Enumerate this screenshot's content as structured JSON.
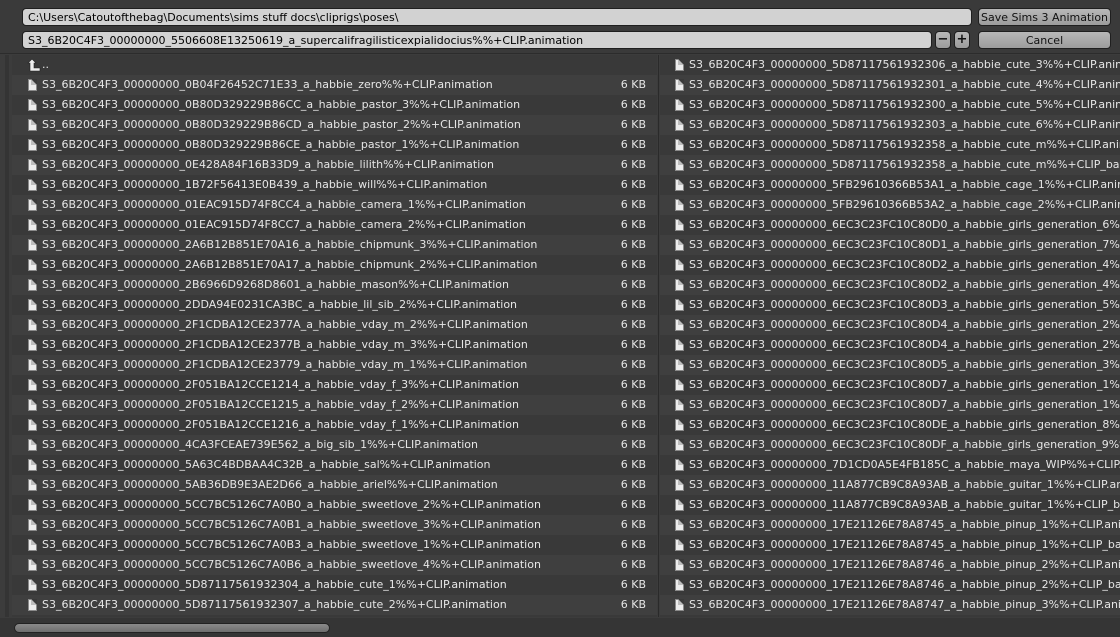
{
  "path": "C:\\Users\\Catoutofthebag\\Documents\\sims stuff docs\\cliprigs\\poses\\",
  "filename": "S3_6B20C4F3_00000000_5506608E13250619_a_supercalifragilisticexpialidocius%%+CLIP.animation",
  "buttons": {
    "save": "Save Sims 3 Animation",
    "cancel": "Cancel",
    "minus": "−",
    "plus": "+"
  },
  "parent_dir": "..",
  "left_files": [
    {
      "name": "S3_6B20C4F3_00000000_0B04F26452C71E33_a_habbie_zero%%+CLIP.animation",
      "size": "6 KB"
    },
    {
      "name": "S3_6B20C4F3_00000000_0B80D329229B86CC_a_habbie_pastor_3%%+CLIP.animation",
      "size": "6 KB"
    },
    {
      "name": "S3_6B20C4F3_00000000_0B80D329229B86CD_a_habbie_pastor_2%%+CLIP.animation",
      "size": "6 KB"
    },
    {
      "name": "S3_6B20C4F3_00000000_0B80D329229B86CE_a_habbie_pastor_1%%+CLIP.animation",
      "size": "6 KB"
    },
    {
      "name": "S3_6B20C4F3_00000000_0E428A84F16B33D9_a_habbie_lilith%%+CLIP.animation",
      "size": "6 KB"
    },
    {
      "name": "S3_6B20C4F3_00000000_1B72F56413E0B439_a_habbie_will%%+CLIP.animation",
      "size": "6 KB"
    },
    {
      "name": "S3_6B20C4F3_00000000_01EAC915D74F8CC4_a_habbie_camera_1%%+CLIP.animation",
      "size": "6 KB"
    },
    {
      "name": "S3_6B20C4F3_00000000_01EAC915D74F8CC7_a_habbie_camera_2%%+CLIP.animation",
      "size": "6 KB"
    },
    {
      "name": "S3_6B20C4F3_00000000_2A6B12B851E70A16_a_habbie_chipmunk_3%%+CLIP.animation",
      "size": "6 KB"
    },
    {
      "name": "S3_6B20C4F3_00000000_2A6B12B851E70A17_a_habbie_chipmunk_2%%+CLIP.animation",
      "size": "6 KB"
    },
    {
      "name": "S3_6B20C4F3_00000000_2B6966D9268D8601_a_habbie_mason%%+CLIP.animation",
      "size": "6 KB"
    },
    {
      "name": "S3_6B20C4F3_00000000_2DDA94E0231CA3BC_a_habbie_lil_sib_2%%+CLIP.animation",
      "size": "6 KB"
    },
    {
      "name": "S3_6B20C4F3_00000000_2F1CDBA12CE2377A_a_habbie_vday_m_2%%+CLIP.animation",
      "size": "6 KB"
    },
    {
      "name": "S3_6B20C4F3_00000000_2F1CDBA12CE2377B_a_habbie_vday_m_3%%+CLIP.animation",
      "size": "6 KB"
    },
    {
      "name": "S3_6B20C4F3_00000000_2F1CDBA12CE23779_a_habbie_vday_m_1%%+CLIP.animation",
      "size": "6 KB"
    },
    {
      "name": "S3_6B20C4F3_00000000_2F051BA12CCE1214_a_habbie_vday_f_3%%+CLIP.animation",
      "size": "6 KB"
    },
    {
      "name": "S3_6B20C4F3_00000000_2F051BA12CCE1215_a_habbie_vday_f_2%%+CLIP.animation",
      "size": "6 KB"
    },
    {
      "name": "S3_6B20C4F3_00000000_2F051BA12CCE1216_a_habbie_vday_f_1%%+CLIP.animation",
      "size": "6 KB"
    },
    {
      "name": "S3_6B20C4F3_00000000_4CA3FCEAE739E562_a_big_sib_1%%+CLIP.animation",
      "size": "6 KB"
    },
    {
      "name": "S3_6B20C4F3_00000000_5A63C4BDBAA4C32B_a_habbie_sal%%+CLIP.animation",
      "size": "6 KB"
    },
    {
      "name": "S3_6B20C4F3_00000000_5AB36DB9E3AE2D66_a_habbie_ariel%%+CLIP.animation",
      "size": "6 KB"
    },
    {
      "name": "S3_6B20C4F3_00000000_5CC7BC5126C7A0B0_a_habbie_sweetlove_2%%+CLIP.animation",
      "size": "6 KB"
    },
    {
      "name": "S3_6B20C4F3_00000000_5CC7BC5126C7A0B1_a_habbie_sweetlove_3%%+CLIP.animation",
      "size": "6 KB"
    },
    {
      "name": "S3_6B20C4F3_00000000_5CC7BC5126C7A0B3_a_habbie_sweetlove_1%%+CLIP.animation",
      "size": "6 KB"
    },
    {
      "name": "S3_6B20C4F3_00000000_5CC7BC5126C7A0B6_a_habbie_sweetlove_4%%+CLIP.animation",
      "size": "6 KB"
    },
    {
      "name": "S3_6B20C4F3_00000000_5D87117561932304_a_habbie_cute_1%%+CLIP.animation",
      "size": "6 KB"
    },
    {
      "name": "S3_6B20C4F3_00000000_5D87117561932307_a_habbie_cute_2%%+CLIP.animation",
      "size": "6 KB"
    }
  ],
  "right_files": [
    "S3_6B20C4F3_00000000_5D87117561932306_a_habbie_cute_3%%+CLIP.animati",
    "S3_6B20C4F3_00000000_5D87117561932301_a_habbie_cute_4%%+CLIP.animati",
    "S3_6B20C4F3_00000000_5D87117561932300_a_habbie_cute_5%%+CLIP.animati",
    "S3_6B20C4F3_00000000_5D87117561932303_a_habbie_cute_6%%+CLIP.animati",
    "S3_6B20C4F3_00000000_5D87117561932358_a_habbie_cute_m%%+CLIP.animati",
    "S3_6B20C4F3_00000000_5D87117561932358_a_habbie_cute_m%%+CLIP_backu",
    "S3_6B20C4F3_00000000_5FB29610366B53A1_a_habbie_cage_1%%+CLIP.animati",
    "S3_6B20C4F3_00000000_5FB29610366B53A2_a_habbie_cage_2%%+CLIP.animati",
    "S3_6B20C4F3_00000000_6EC3C23FC10C80D0_a_habbie_girls_generation_6%%+C",
    "S3_6B20C4F3_00000000_6EC3C23FC10C80D1_a_habbie_girls_generation_7%%+C",
    "S3_6B20C4F3_00000000_6EC3C23FC10C80D2_a_habbie_girls_generation_4%%+C",
    "S3_6B20C4F3_00000000_6EC3C23FC10C80D2_a_habbie_girls_generation_4%%+C",
    "S3_6B20C4F3_00000000_6EC3C23FC10C80D3_a_habbie_girls_generation_5%%+C",
    "S3_6B20C4F3_00000000_6EC3C23FC10C80D4_a_habbie_girls_generation_2%%+C",
    "S3_6B20C4F3_00000000_6EC3C23FC10C80D4_a_habbie_girls_generation_2%%+C",
    "S3_6B20C4F3_00000000_6EC3C23FC10C80D5_a_habbie_girls_generation_3%%+C",
    "S3_6B20C4F3_00000000_6EC3C23FC10C80D7_a_habbie_girls_generation_1%%+C",
    "S3_6B20C4F3_00000000_6EC3C23FC10C80D7_a_habbie_girls_generation_1%%+C",
    "S3_6B20C4F3_00000000_6EC3C23FC10C80DE_a_habbie_girls_generation_8%%+C",
    "S3_6B20C4F3_00000000_6EC3C23FC10C80DF_a_habbie_girls_generation_9%%+C",
    "S3_6B20C4F3_00000000_7D1CD0A5E4FB185C_a_habbie_maya_WIP%%+CLIP.anim",
    "S3_6B20C4F3_00000000_11A877CB9C8A93AB_a_habbie_guitar_1%%+CLIP.anima",
    "S3_6B20C4F3_00000000_11A877CB9C8A93AB_a_habbie_guitar_1%%+CLIP_backu",
    "S3_6B20C4F3_00000000_17E21126E78A8745_a_habbie_pinup_1%%+CLIP.animat",
    "S3_6B20C4F3_00000000_17E21126E78A8745_a_habbie_pinup_1%%+CLIP_backup",
    "S3_6B20C4F3_00000000_17E21126E78A8746_a_habbie_pinup_2%%+CLIP.animat",
    "S3_6B20C4F3_00000000_17E21126E78A8746_a_habbie_pinup_2%%+CLIP_backup",
    "S3_6B20C4F3_00000000_17E21126E78A8747_a_habbie_pinup_3%%+CLIP.animat"
  ]
}
